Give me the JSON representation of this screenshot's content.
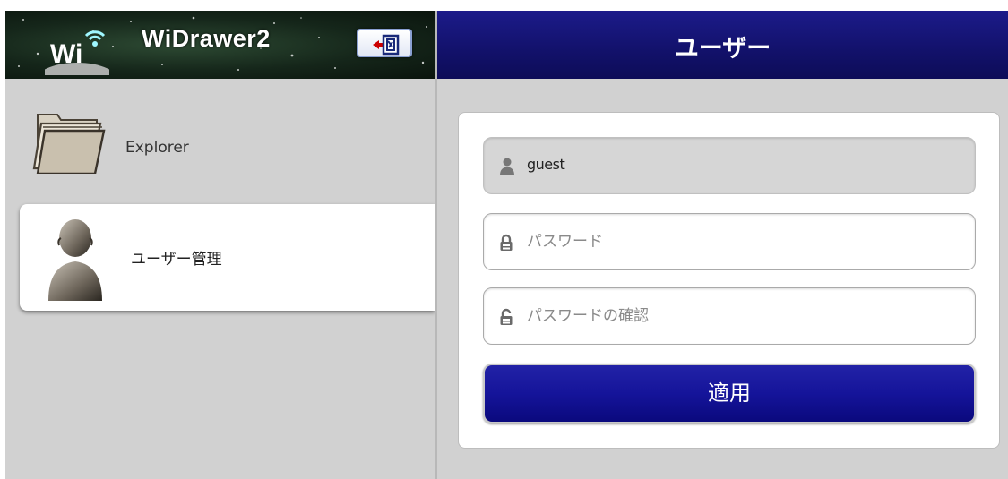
{
  "sidebar": {
    "app_title": "WiDrawer2",
    "logo_text": "Wi",
    "items": [
      {
        "label": "Explorer",
        "icon": "folder-icon"
      },
      {
        "label": "ユーザー管理",
        "icon": "user-icon",
        "selected": true
      }
    ]
  },
  "main": {
    "title": "ユーザー",
    "form": {
      "username": "guest",
      "password_placeholder": "パスワード",
      "password_confirm_placeholder": "パスワードの確認",
      "apply_label": "適用"
    }
  },
  "colors": {
    "header_blue": "#15149a",
    "sidebar_bg": "#d1d1d1",
    "header_green": "#1f3425"
  }
}
